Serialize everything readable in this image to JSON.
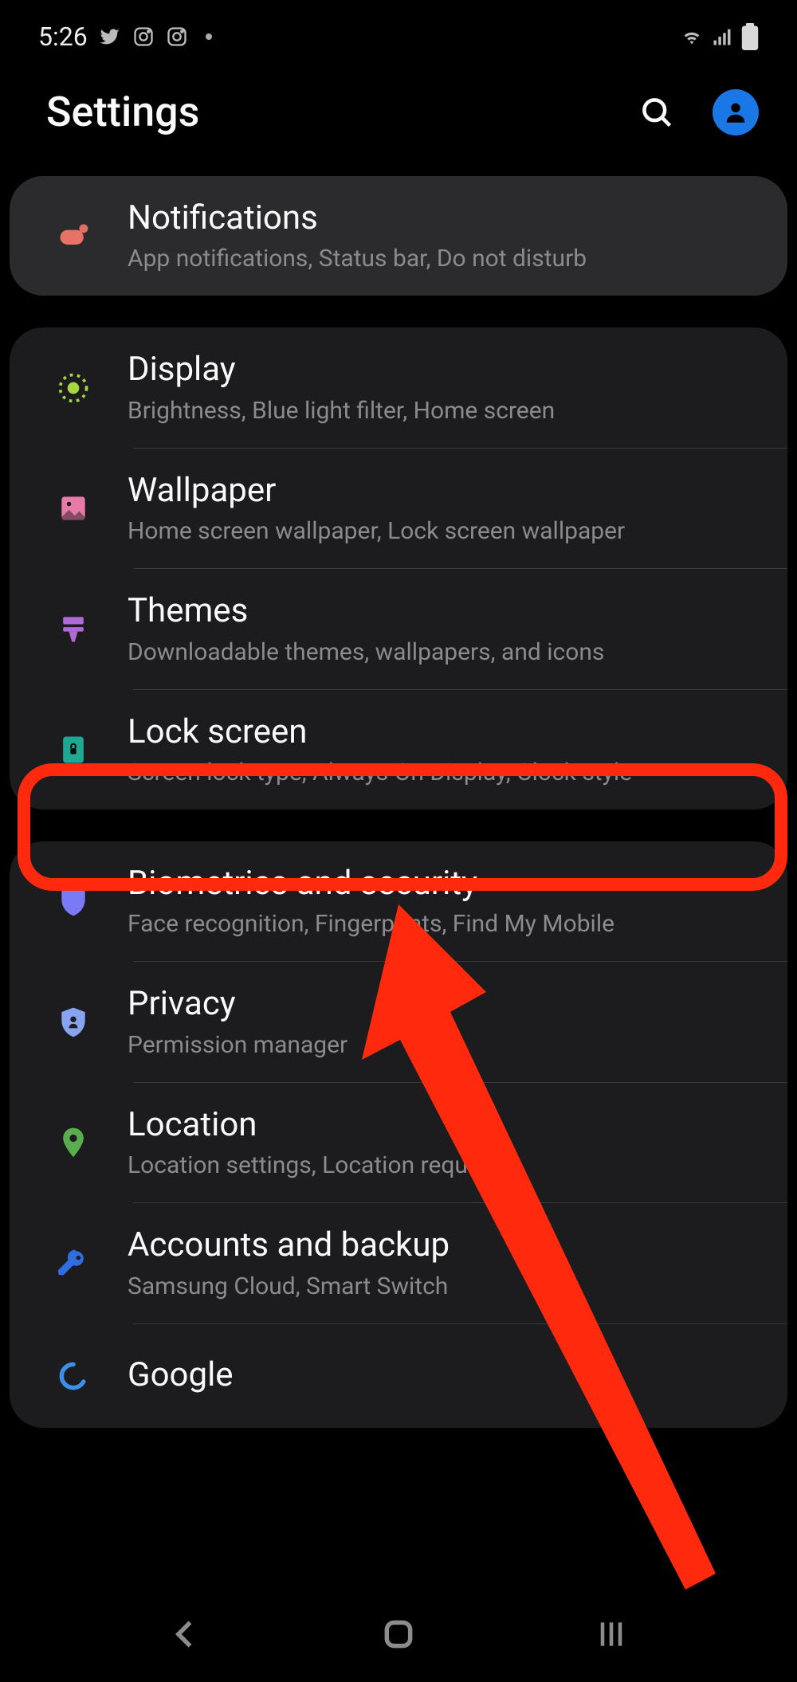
{
  "status": {
    "time": "5:26"
  },
  "header": {
    "title": "Settings"
  },
  "groups": [
    {
      "highlight": true,
      "items": [
        {
          "key": "notifications",
          "title": "Notifications",
          "sub": "App notifications, Status bar, Do not disturb",
          "iconColor": "#e97266"
        }
      ]
    },
    {
      "items": [
        {
          "key": "display",
          "title": "Display",
          "sub": "Brightness, Blue light filter, Home screen",
          "iconColor": "#a3d93f"
        },
        {
          "key": "wallpaper",
          "title": "Wallpaper",
          "sub": "Home screen wallpaper, Lock screen wallpaper",
          "iconColor": "#e77aa6"
        },
        {
          "key": "themes",
          "title": "Themes",
          "sub": "Downloadable themes, wallpapers, and icons",
          "iconColor": "#b06ad8"
        },
        {
          "key": "lockscreen",
          "title": "Lock screen",
          "sub": "Screen lock type, Always On Display, Clock style",
          "iconColor": "#1fa893",
          "boxed": true
        }
      ]
    },
    {
      "items": [
        {
          "key": "biometrics",
          "title": "Biometrics and security",
          "sub": "Face recognition, Fingerprints, Find My Mobile",
          "iconColor": "#7a7af7"
        },
        {
          "key": "privacy",
          "title": "Privacy",
          "sub": "Permission manager",
          "iconColor": "#88a3ef"
        },
        {
          "key": "location",
          "title": "Location",
          "sub": "Location settings, Location requests",
          "iconColor": "#5aad4e"
        },
        {
          "key": "accounts",
          "title": "Accounts and backup",
          "sub": "Samsung Cloud, Smart Switch",
          "iconColor": "#2f6de0"
        },
        {
          "key": "google",
          "title": "Google",
          "sub": "",
          "iconColor": "#3b8fe8"
        }
      ]
    }
  ]
}
